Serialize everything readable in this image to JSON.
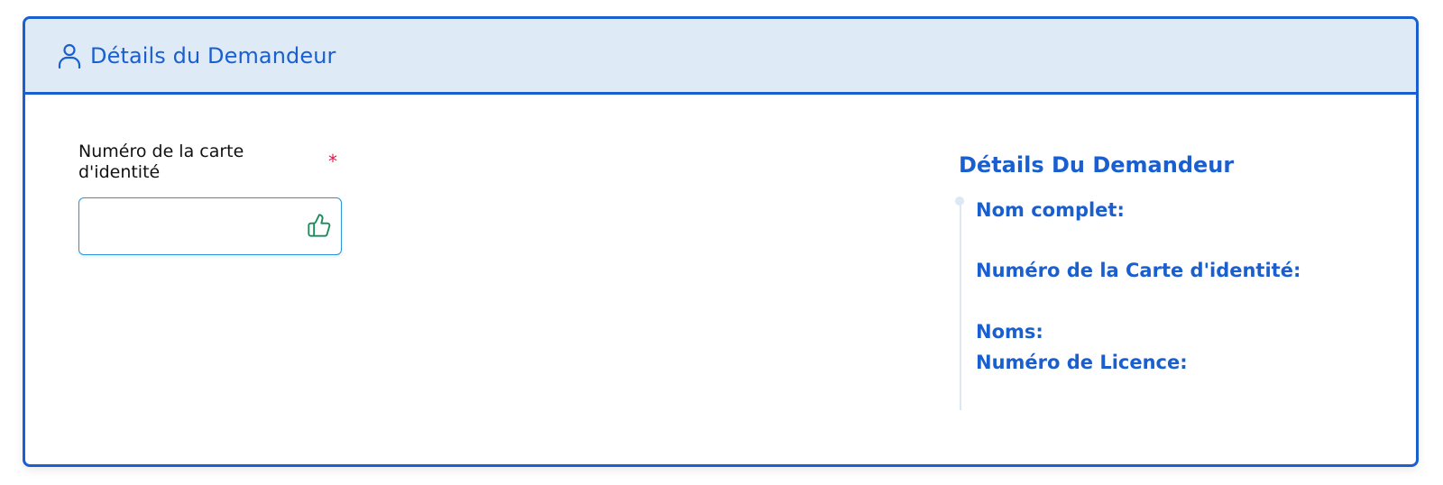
{
  "section": {
    "title": "Détails du Demandeur",
    "icon": "user-icon"
  },
  "form": {
    "id_card_label": "Numéro de la carte d'identité",
    "required_mark": "*",
    "id_card_value": "",
    "input_icon": "thumbs-up-icon"
  },
  "details": {
    "title": "Détails Du Demandeur",
    "items": [
      "Nom complet:",
      "Numéro de la Carte d'identité:",
      "Noms:",
      "Numéro de Licence:"
    ]
  },
  "colors": {
    "primary": "#1a5fd0",
    "header_bg": "#deebf7",
    "required": "#e0194a",
    "thumb": "#1a8a5a",
    "input_border": "#2b93d6"
  }
}
